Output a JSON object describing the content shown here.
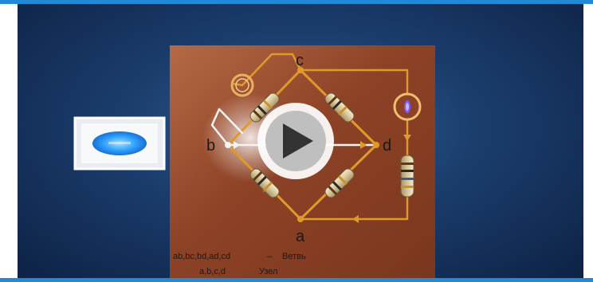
{
  "nodes": {
    "a": "a",
    "b": "b",
    "c": "c",
    "d": "d"
  },
  "caption": {
    "branches_list": "ab,bc,bd,ad,cd",
    "branches_dash": "–",
    "branches_term": "Ветвь",
    "nodes_list": "a,b,c,d",
    "nodes_term": "Узел"
  },
  "video": {
    "play_icon": "play-icon"
  },
  "colors": {
    "frame_accent": "#1f8ad8",
    "board": "#8d4226",
    "wire_orange": "#e09a2a",
    "wire_white": "#f4f4f4"
  }
}
